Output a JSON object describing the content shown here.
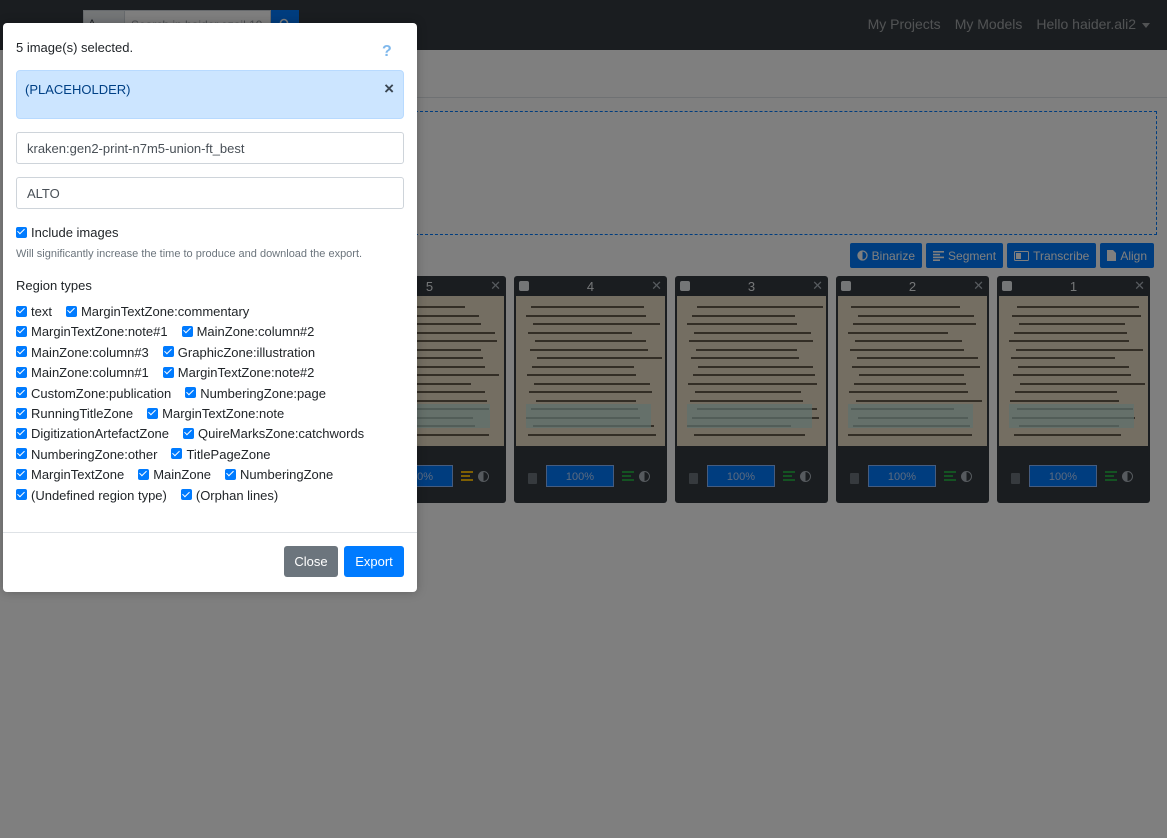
{
  "navbar": {
    "search_scope": "A",
    "search_placeholder": "Search in haider.ezail.19",
    "links": [
      "My Projects",
      "My Models"
    ],
    "user_menu": "Hello haider.ali2"
  },
  "toolbar": {
    "binarize": "Binarize",
    "segment": "Segment",
    "transcribe": "Transcribe",
    "align": "Align"
  },
  "cards": [
    {
      "number": "5",
      "progress": "100%"
    },
    {
      "number": "4",
      "progress": "100%"
    },
    {
      "number": "3",
      "progress": "100%"
    },
    {
      "number": "2",
      "progress": "100%"
    },
    {
      "number": "1",
      "progress": "100%"
    }
  ],
  "modal": {
    "selected_text": "5 image(s) selected.",
    "help_icon": "?",
    "alert_text": "(PLACEHOLDER)",
    "alert_close": "×",
    "transcription_value": "kraken:gen2-print-n7m5-union-ft_best",
    "format_value": "ALTO",
    "include_images_label": "Include images",
    "include_images_checked": true,
    "include_images_help": "Will significantly increase the time to produce and download the export.",
    "region_types_title": "Region types",
    "region_rows": [
      [
        "text",
        "MarginTextZone:commentary"
      ],
      [
        "MarginTextZone:note#1",
        "MainZone:column#2"
      ],
      [
        "MainZone:column#3",
        "GraphicZone:illustration"
      ],
      [
        "MainZone:column#1",
        "MarginTextZone:note#2"
      ],
      [
        "CustomZone:publication",
        "NumberingZone:page"
      ],
      [
        "RunningTitleZone",
        "MarginTextZone:note"
      ],
      [
        "DigitizationArtefactZone",
        "QuireMarksZone:catchwords"
      ],
      [
        "NumberingZone:other",
        "TitlePageZone"
      ],
      [
        "MarginTextZone",
        "MainZone",
        "NumberingZone"
      ],
      [
        "(Undefined region type)",
        "(Orphan lines)"
      ]
    ],
    "close_button": "Close",
    "export_button": "Export"
  },
  "colors": {
    "primary": "#007bff",
    "secondary": "#6c757d",
    "navbar": "#343a40",
    "alert_bg": "#cce5ff"
  }
}
